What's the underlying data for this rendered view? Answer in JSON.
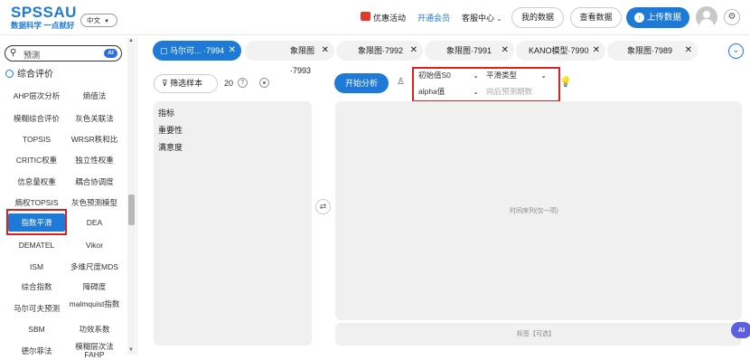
{
  "header": {
    "logo": "SPSSAU",
    "slogan": "数据科学 一点就好",
    "lang": "中文",
    "promo": "优惠活动",
    "membership": "开通会员",
    "service": "客服中心",
    "my_data": "我的数据",
    "view_data": "查看数据",
    "upload": "上传数据"
  },
  "sidebar": {
    "search_text": "预测",
    "ai_badge": "AI",
    "category": "综合评价",
    "methods": [
      [
        "AHP层次分析",
        "熵值法"
      ],
      [
        "模糊综合评价",
        "灰色关联法"
      ],
      [
        "TOPSIS",
        "WRSR秩和比"
      ],
      [
        "CRITIC权重",
        "独立性权重"
      ],
      [
        "信息量权重",
        "耦合协调度"
      ],
      [
        "熵权TOPSIS",
        "灰色预测模型"
      ],
      [
        "指数平滑",
        "DEA"
      ],
      [
        "DEMATEL",
        "Vikor"
      ],
      [
        "ISM",
        "多维尺度MDS"
      ],
      [
        "综合指数",
        "障碍度"
      ],
      [
        "马尔可夫预测",
        "malmquist指数"
      ],
      [
        "SBM",
        "功效系数"
      ],
      [
        "德尔菲法",
        "模糊层次法FAHP"
      ]
    ]
  },
  "tabs": [
    {
      "label": "马尔可...",
      "id": "·7994",
      "active": true
    },
    {
      "label": "象限图·7993"
    },
    {
      "label": "象限图·7992"
    },
    {
      "label": "象限图·7991"
    },
    {
      "label": "KANO模型·7990"
    },
    {
      "label": "象限图·7989"
    }
  ],
  "left_panel": {
    "filter": "筛选样本",
    "count": "20",
    "help": "?",
    "variables": [
      "指标",
      "重要性",
      "满意度"
    ]
  },
  "right_panel": {
    "start": "开始分析",
    "params": {
      "initial": "初始值S0",
      "smooth_type": "平滑类型",
      "alpha": "alpha值",
      "forecast_placeholder": "向后预测期数"
    },
    "time_series_hint": "时间序列(仅一项)",
    "label_hint": "标签【可选】"
  },
  "colors": {
    "accent": "#1e7ad6",
    "highlight": "#e02020",
    "panel": "#f0f0f0"
  },
  "ai_float": "AI"
}
